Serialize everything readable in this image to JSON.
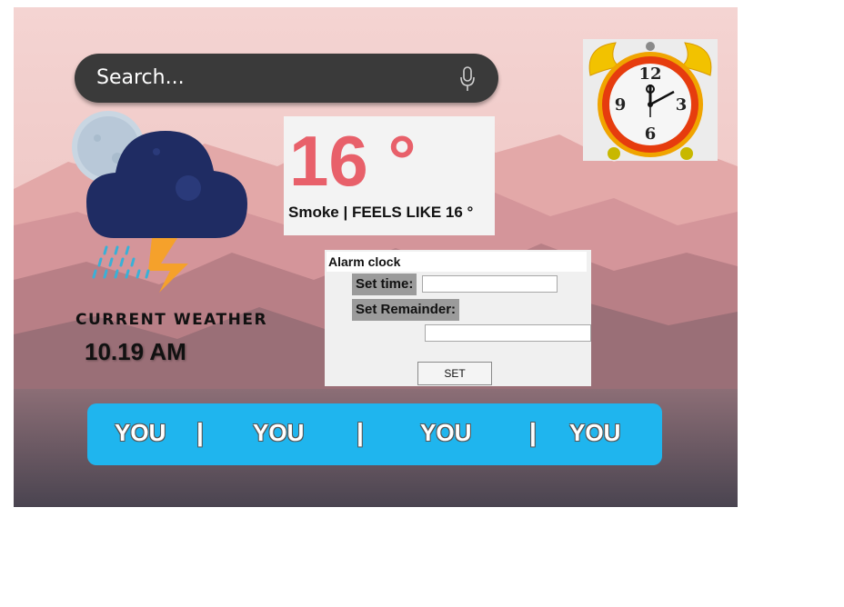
{
  "search": {
    "placeholder": "Search...",
    "icon": "mic-icon"
  },
  "weather": {
    "icon": "cloud-moon-rain-lightning-icon",
    "label": "CURRENT WEATHER",
    "time": "10.19 AM",
    "temperature": "16 °",
    "description": "Smoke | FEELS LIKE 16 °"
  },
  "clock": {
    "icon": "alarm-clock-icon",
    "numerals": [
      "12",
      "3",
      "6",
      "9"
    ],
    "colors": {
      "bell": "#f2c200",
      "ring": "#e63c0e"
    }
  },
  "alarm": {
    "title": "Alarm clock",
    "set_time_label": "Set time:",
    "set_reminder_label": "Set Remainder:",
    "set_time_value": "",
    "reminder_value": "",
    "set_button": "SET"
  },
  "nav": {
    "items": [
      "YOU",
      "YOU",
      "YOU",
      "YOU"
    ],
    "separator": "|",
    "color": "#1fb5ee"
  }
}
